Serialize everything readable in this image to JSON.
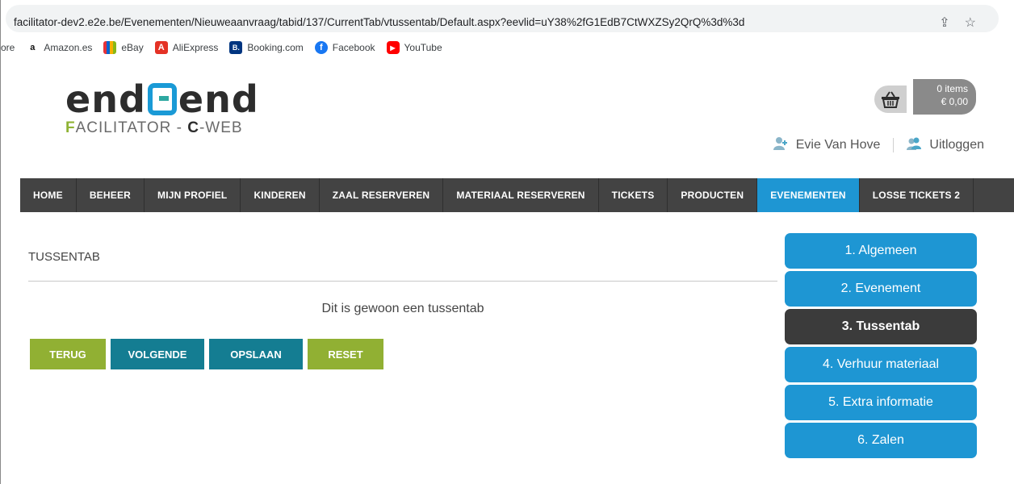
{
  "browser": {
    "url": "facilitator-dev2.e2e.be/Evenementen/Nieuweaanvraag/tabid/137/CurrentTab/vtussentab/Default.aspx?eevlid=uY38%2fG1EdB7CtWXZSy2QrQ%3d%3d",
    "bookmarks": [
      {
        "label": "ore",
        "icon": ""
      },
      {
        "label": "Amazon.es",
        "icon": "a"
      },
      {
        "label": "eBay",
        "icon": "e"
      },
      {
        "label": "AliExpress",
        "icon": "A"
      },
      {
        "label": "Booking.com",
        "icon": "B."
      },
      {
        "label": "Facebook",
        "icon": "f"
      },
      {
        "label": "YouTube",
        "icon": "▶"
      }
    ]
  },
  "logo": {
    "main_left": "end",
    "main_right": "end",
    "sub_f": "F",
    "sub_mid": "ACILITATOR - ",
    "sub_c": "C",
    "sub_end": "-WEB"
  },
  "basket": {
    "items": "0 items",
    "total": "€ 0,00"
  },
  "user": {
    "name": "Evie Van Hove",
    "logout": "Uitloggen"
  },
  "nav": [
    {
      "label": "HOME",
      "active": false
    },
    {
      "label": "BEHEER",
      "active": false
    },
    {
      "label": "MIJN PROFIEL",
      "active": false
    },
    {
      "label": "KINDEREN",
      "active": false
    },
    {
      "label": "ZAAL RESERVEREN",
      "active": false
    },
    {
      "label": "MATERIAAL RESERVEREN",
      "active": false
    },
    {
      "label": "TICKETS",
      "active": false
    },
    {
      "label": "PRODUCTEN",
      "active": false
    },
    {
      "label": "EVENEMENTEN",
      "active": true
    },
    {
      "label": "LOSSE TICKETS 2",
      "active": false
    }
  ],
  "main": {
    "title": "TUSSENTAB",
    "text": "Dit is gewoon een tussentab",
    "buttons": {
      "back": "TERUG",
      "next": "VOLGENDE",
      "save": "OPSLAAN",
      "reset": "RESET"
    }
  },
  "steps": [
    {
      "label": "1. Algemeen",
      "active": false
    },
    {
      "label": "2. Evenement",
      "active": false
    },
    {
      "label": "3. Tussentab",
      "active": true
    },
    {
      "label": "4. Verhuur materiaal",
      "active": false
    },
    {
      "label": "5. Extra informatie",
      "active": false
    },
    {
      "label": "6. Zalen",
      "active": false
    }
  ],
  "colors": {
    "nav_bg": "#434343",
    "accent_blue": "#1e96d3",
    "green": "#91b033",
    "teal": "#147d92"
  }
}
